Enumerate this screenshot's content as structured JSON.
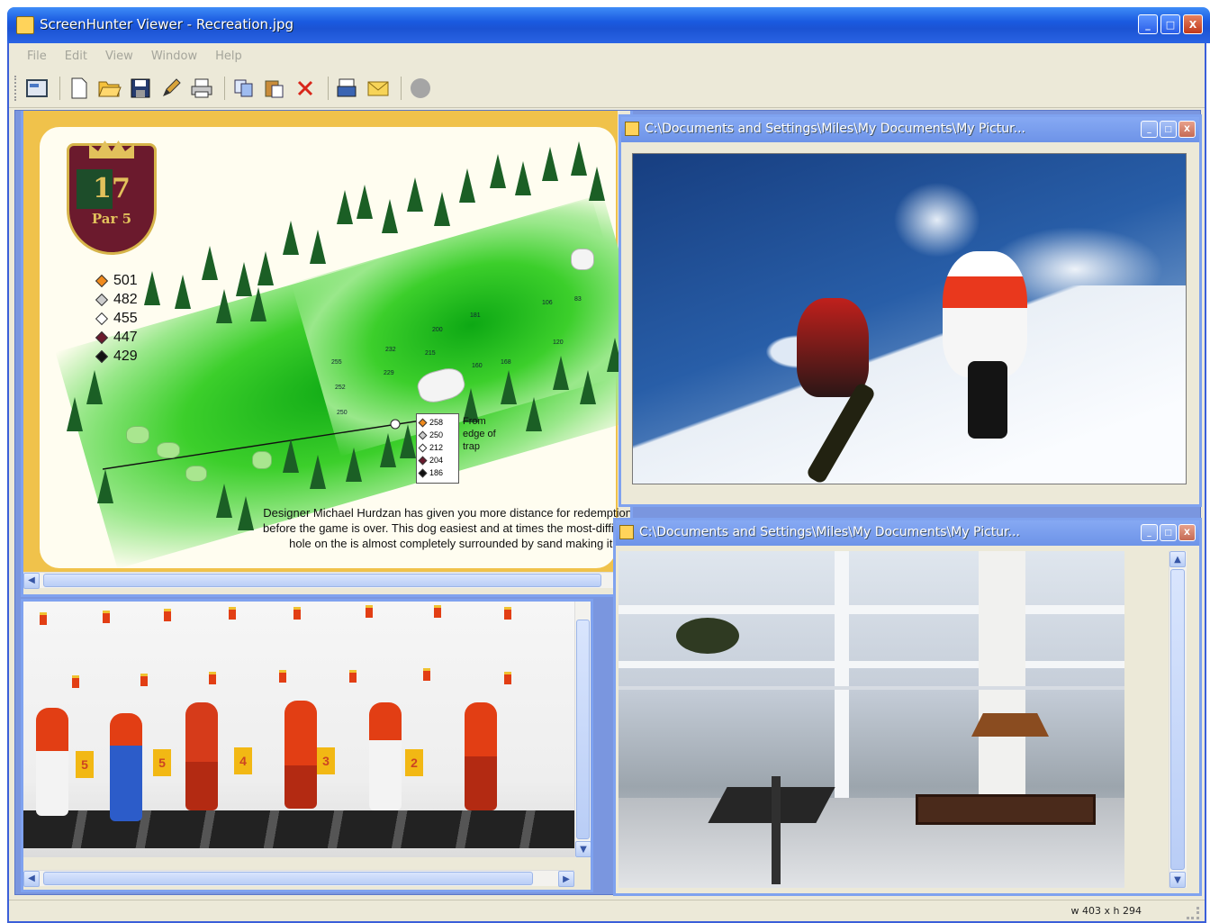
{
  "window": {
    "title": "ScreenHunter Viewer - Recreation.jpg",
    "controls": [
      "_",
      "□",
      "X"
    ]
  },
  "menu": [
    "File",
    "Edit",
    "View",
    "Window",
    "Help"
  ],
  "toolbar": {
    "buttons": [
      "thumbnail-icon",
      "new-icon",
      "open-icon",
      "save-icon",
      "edit-icon",
      "print-icon",
      "copy-icon",
      "paste-icon",
      "delete-icon",
      "scan-icon",
      "email-icon",
      "stop-icon"
    ]
  },
  "children": {
    "snowboard": {
      "title": "C:\\Documents and Settings\\Miles\\My Documents\\My Pictur..."
    },
    "sunroom": {
      "title": "C:\\Documents and Settings\\Miles\\My Documents\\My Pictur..."
    }
  },
  "golf": {
    "hole_number": "17",
    "par": "Par 5",
    "yardages": [
      {
        "value": "501",
        "color": "#f08a1c"
      },
      {
        "value": "482",
        "color": "#cccccc"
      },
      {
        "value": "455",
        "color": "#ffffff"
      },
      {
        "value": "447",
        "color": "#6b1a2d"
      },
      {
        "value": "429",
        "color": "#111111"
      }
    ],
    "trap_distances": [
      {
        "value": "258",
        "color": "#f08a1c"
      },
      {
        "value": "250",
        "color": "#cccccc"
      },
      {
        "value": "212",
        "color": "#ffffff"
      },
      {
        "value": "204",
        "color": "#6b1a2d"
      },
      {
        "value": "186",
        "color": "#111111"
      }
    ],
    "trap_label": "From edge of trap",
    "description": "Designer Michael Hurdzan has given you more distance for redemption before the game is over. This dog easiest and at times the most-difficult hole on the is almost completely surrounded by sand making it a d",
    "course_marks": [
      "106",
      "83",
      "181",
      "120",
      "200",
      "232",
      "215",
      "255",
      "252",
      "229",
      "250",
      "168",
      "160"
    ]
  },
  "biathlon": {
    "target_numbers": [
      "5",
      "5",
      "4",
      "3",
      "2"
    ]
  },
  "status": {
    "size": "w 403 x h 294"
  }
}
